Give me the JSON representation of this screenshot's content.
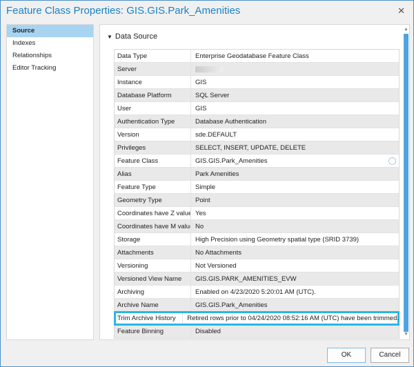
{
  "title": "Feature Class Properties: GIS.GIS.Park_Amenities",
  "nav": [
    "Source",
    "Indexes",
    "Relationships",
    "Editor Tracking"
  ],
  "section": "Data Source",
  "rows": [
    [
      "Data Type",
      "Enterprise Geodatabase Feature Class"
    ],
    [
      "Server",
      ""
    ],
    [
      "Instance",
      "GIS"
    ],
    [
      "Database Platform",
      "SQL Server"
    ],
    [
      "User",
      "GIS"
    ],
    [
      "Authentication Type",
      "Database Authentication"
    ],
    [
      "Version",
      "sde.DEFAULT"
    ],
    [
      "Privileges",
      "SELECT, INSERT, UPDATE, DELETE"
    ],
    [
      "Feature Class",
      "GIS.GIS.Park_Amenities"
    ],
    [
      "Alias",
      "Park Amenities"
    ],
    [
      "Feature Type",
      "Simple"
    ],
    [
      "Geometry Type",
      "Point"
    ],
    [
      "Coordinates have Z value",
      "Yes"
    ],
    [
      "Coordinates have M value",
      "No"
    ],
    [
      "Storage",
      "High Precision using Geometry spatial type (SRID 3739)"
    ],
    [
      "Attachments",
      "No Attachments"
    ],
    [
      "Versioning",
      "Not Versioned"
    ],
    [
      "Versioned View Name",
      "GIS.GIS.PARK_AMENITIES_EVW"
    ],
    [
      "Archiving",
      "Enabled on 4/23/2020 5:20:01 AM (UTC)."
    ],
    [
      "Archive Name",
      "GIS.GIS.Park_Amenities"
    ],
    [
      "Trim Archive History",
      "Retired rows prior to 04/24/2020 08:52:16 AM (UTC) have been trimmed."
    ],
    [
      "Feature Binning",
      "Disabled"
    ]
  ],
  "buttons": {
    "ok": "OK",
    "cancel": "Cancel"
  },
  "colors": {
    "accent": "#1a82c4",
    "highlight": "#29b6e6",
    "selected": "#a8d4f2"
  }
}
